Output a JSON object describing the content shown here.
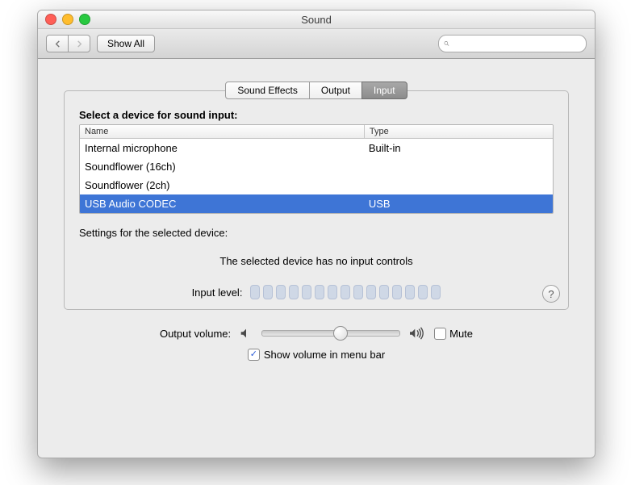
{
  "window": {
    "title": "Sound"
  },
  "toolbar": {
    "show_all_label": "Show All",
    "search_placeholder": ""
  },
  "tabs": [
    {
      "label": "Sound Effects",
      "active": false
    },
    {
      "label": "Output",
      "active": false
    },
    {
      "label": "Input",
      "active": true
    }
  ],
  "input_panel": {
    "select_device_label": "Select a device for sound input:",
    "columns": {
      "name": "Name",
      "type": "Type"
    },
    "devices": [
      {
        "name": "Internal microphone",
        "type": "Built-in",
        "selected": false
      },
      {
        "name": "Soundflower (16ch)",
        "type": "",
        "selected": false
      },
      {
        "name": "Soundflower (2ch)",
        "type": "",
        "selected": false
      },
      {
        "name": "USB Audio CODEC",
        "type": "USB",
        "selected": true
      }
    ],
    "settings_label": "Settings for the selected device:",
    "no_controls_text": "The selected device has no input controls",
    "input_level_label": "Input level:",
    "input_level_segments": 15
  },
  "output": {
    "label": "Output volume:",
    "mute_label": "Mute",
    "mute_checked": false,
    "show_in_menubar_label": "Show volume in menu bar",
    "show_in_menubar_checked": true
  },
  "help_label": "?"
}
